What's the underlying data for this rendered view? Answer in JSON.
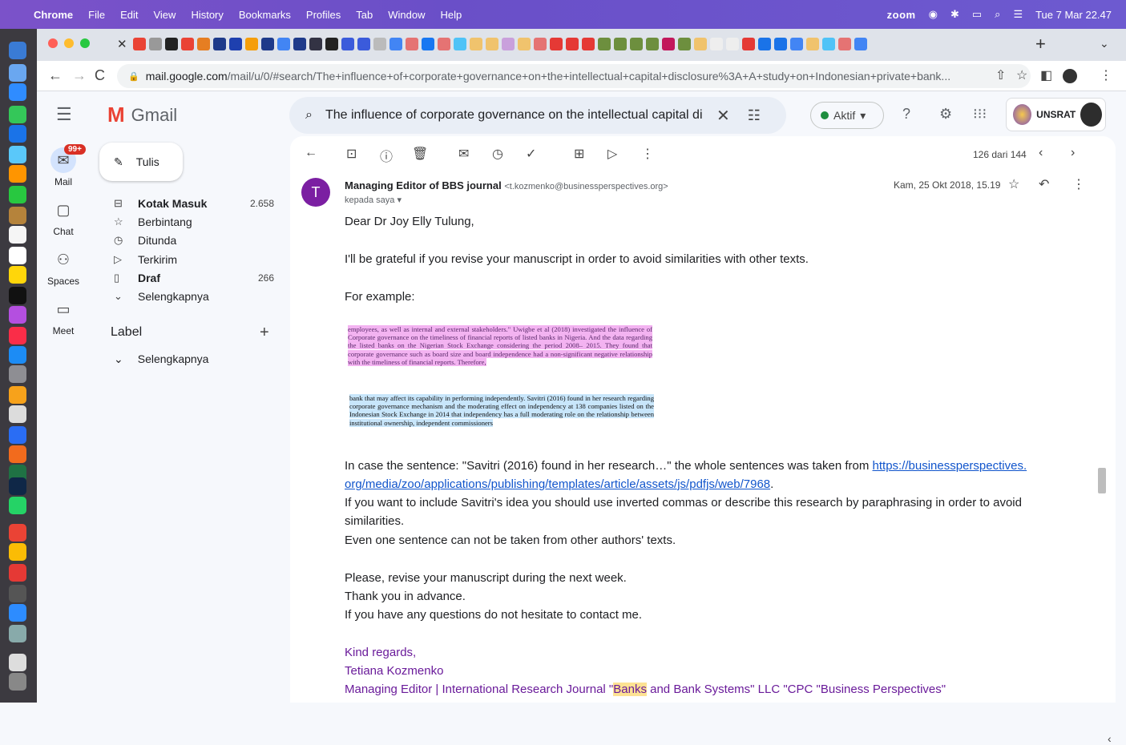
{
  "menubar": {
    "items": [
      "Chrome",
      "File",
      "Edit",
      "View",
      "History",
      "Bookmarks",
      "Profiles",
      "Tab",
      "Window",
      "Help"
    ],
    "zoom": "zoom",
    "clock": "Tue 7 Mar 22.47"
  },
  "browser": {
    "url_host": "mail.google.com",
    "url_path": "/mail/u/0/#search/The+influence+of+corporate+governance+on+the+intellectual+capital+disclosure%3A+A+study+on+Indonesian+private+bank..."
  },
  "gmail": {
    "logo_text": "Gmail",
    "search_query": "The influence of corporate governance on the intellectual capital di",
    "status_label": "Aktif",
    "account_label": "UNSRAT",
    "rail": [
      {
        "label": "Mail",
        "badge": "99+"
      },
      {
        "label": "Chat"
      },
      {
        "label": "Spaces"
      },
      {
        "label": "Meet"
      }
    ],
    "compose_label": "Tulis",
    "folders": [
      {
        "label": "Kotak Masuk",
        "count": "2.658"
      },
      {
        "label": "Berbintang",
        "count": ""
      },
      {
        "label": "Ditunda",
        "count": ""
      },
      {
        "label": "Terkirim",
        "count": ""
      },
      {
        "label": "Draf",
        "count": "266"
      },
      {
        "label": "Selengkapnya",
        "count": ""
      }
    ],
    "labels_header": "Label",
    "labels_more": "Selengkapnya"
  },
  "message": {
    "pager": "126 dari 144",
    "avatar_letter": "T",
    "sender_name": "Managing Editor of BBS journal",
    "sender_email": "<t.kozmenko@businessperspectives.org>",
    "to": "kepada saya",
    "date": "Kam, 25 Okt 2018, 15.19",
    "greeting": "Dear Dr Joy Elly Tulung,",
    "p1": "I'll be grateful if you revise your manuscript in order to avoid similarities with other texts.",
    "p2": "For example:",
    "excerpt1": "employees, as well as internal and external stakeholders.\" Uwigbe et al (2018) investigated the influence of Corporate governance on the timeliness of financial reports of listed banks in Nigeria. And the data regarding the listed banks on the Nigerian Stock Exchange considering the period 2008– 2015. They found that corporate governance such as board size and board independence had a non-significant negative relationship with the timeliness of financial reports. Therefore,",
    "excerpt2": "bank that may affect its capability in performing independently. Savitri (2016) found in her research regarding corporate governance mechanism and the moderating effect on independency at 138 companies listed on the Indonesian Stock Exchange in 2014 that independency has a full moderating role on the relationship between institutional ownership, independent commissioners",
    "p3_prefix": "In case the sentence: \"Savitri (2016) found in her research…\" the whole sentences was taken from",
    "link_line1": "https://businessperspectives.",
    "link_line2": "org/media/zoo/applications/publishing/templates/article/assets/js/pdfjs/web/7968",
    "p4": "If you want to include Savitri's idea you should use inverted commas or describe this research by paraphrasing in order to avoid similarities.",
    "p5": "Even one sentence can not be taken from other authors' texts.",
    "p6": "Please, revise your manuscript during the next week.",
    "p7": "Thank you in advance.",
    "p8": "If you have any questions do not hesitate to contact me.",
    "sig1": "Kind regards,",
    "sig2": "Tetiana Kozmenko",
    "sig3_a": "Managing Editor | International Research Journal \"",
    "sig3_hl": "Banks",
    "sig3_b": " and Bank Systems\" LLC \"CPC \"Business Perspectives\""
  }
}
